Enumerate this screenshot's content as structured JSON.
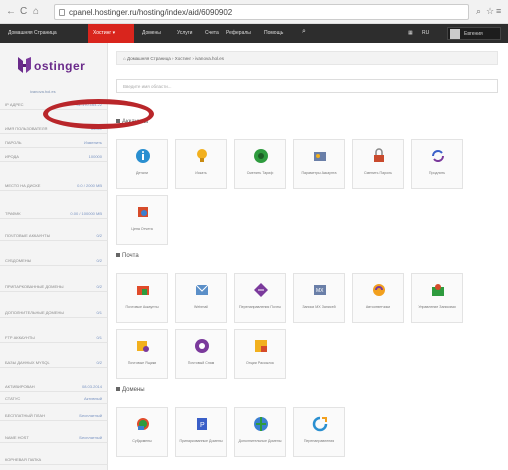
{
  "browser": {
    "url": "cpanel.hostinger.ru/hosting/index/aid/6090902",
    "back_icon": "back-arrow-icon",
    "reload_icon": "reload-icon",
    "home_icon": "home-icon"
  },
  "topnav": {
    "items": [
      "Домашняя Страница",
      "Хостинг",
      "Домены",
      "Услуги",
      "Счета",
      "Рефералы",
      "Помощь"
    ],
    "active": "Хостинг ▾",
    "lang": "RU",
    "user": "Евгения"
  },
  "sidebar": {
    "logo_text": "ostinger",
    "account": "ivanova.hol.es",
    "rows": [
      {
        "label": "IP адрес",
        "value": "31.170.164.22"
      },
      {
        "label": "Имя пользователя",
        "value": "u5061"
      },
      {
        "label": "Пароль",
        "value": "Изменить"
      },
      {
        "label": "Ирода",
        "value": "100000"
      },
      {
        "label": "Место на диске",
        "value": "0.0 / 2000 MB"
      },
      {
        "label": "Трафик",
        "value": "0.00 / 100000 MB"
      },
      {
        "label": "Почтовые аккаунты",
        "value": "0/2"
      },
      {
        "label": "Субдомены",
        "value": "0/2"
      },
      {
        "label": "Припаркованные домены",
        "value": "0/2"
      },
      {
        "label": "Дополнительные домены",
        "value": "0/1"
      },
      {
        "label": "FTP аккаунты",
        "value": "0/1"
      },
      {
        "label": "Базы данных MySQL",
        "value": "0/2"
      },
      {
        "label": "Активирован",
        "value": "08.03.2014"
      },
      {
        "label": "Статус",
        "value": "Активный"
      },
      {
        "label": "Бесплатный план",
        "value": "Бесплатный"
      },
      {
        "label": "Name Host",
        "value": "Бесплатный"
      },
      {
        "label": "Корневая папка",
        "value": ""
      }
    ]
  },
  "main": {
    "breadcrumb": "⌂ Домашняя Страница  ›  Хостинг  ›  ivanova.hol.es",
    "search_placeholder": "Введите имя области...",
    "sections": [
      {
        "title": "Аккаунты",
        "tiles": [
          "Детали",
          "Искать",
          "Сменить Тариф",
          "Параметры Аккаунта",
          "Сменить Пароль",
          "Продлить",
          "Цена Отчета"
        ]
      },
      {
        "title": "Почта",
        "tiles": [
          "Почтовые Аккаунты",
          "Webmail",
          "Перенаправления Почты",
          "Записи MX Записей",
          "Автоответчики",
          "Управление Записями",
          "Почтовые Ящики",
          "Почтовый Спам",
          "Опции Рассылок"
        ]
      },
      {
        "title": "Домены",
        "tiles": [
          "Субдомены",
          "Припаркованные Домены",
          "Дополнительные Домены",
          "Перенаправления"
        ]
      }
    ]
  },
  "colors": {
    "accent": "#d9251d",
    "annotation": "#b9262a",
    "brand": "#6a2a8a"
  }
}
